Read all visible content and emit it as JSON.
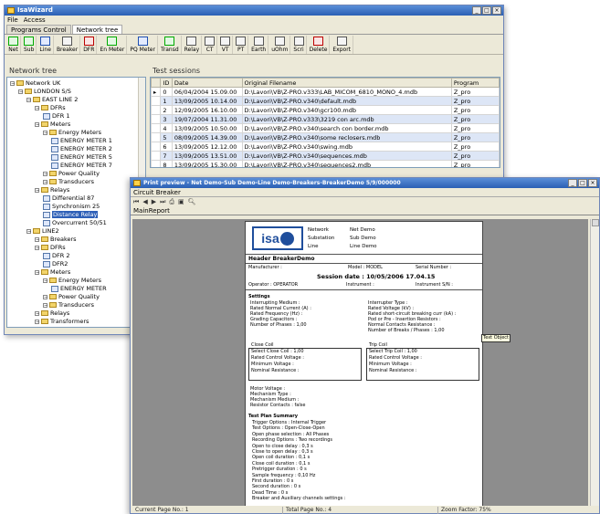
{
  "main": {
    "title": "IsaWizard",
    "menu": [
      "File",
      "Access"
    ],
    "tabs": [
      "Programs Control",
      "Network tree"
    ],
    "toolbar": [
      "Net",
      "Sub",
      "Line",
      "Breaker",
      "DFR",
      "En Meter",
      "PQ Meter",
      "Transd",
      "Relay",
      "CT",
      "VT",
      "PT",
      "Earth",
      "uOhm",
      "Scri",
      "Delete",
      "Export"
    ],
    "tree_title": "Network tree",
    "tree": [
      {
        "label": "Network UK",
        "depth": 0,
        "kind": "net"
      },
      {
        "label": "LONDON S/S",
        "depth": 1,
        "kind": "sub"
      },
      {
        "label": "EAST LINE 2",
        "depth": 2,
        "kind": "line"
      },
      {
        "label": "DFRs",
        "depth": 3,
        "kind": "folder"
      },
      {
        "label": "DFR 1",
        "depth": 4,
        "kind": "dev"
      },
      {
        "label": "Meters",
        "depth": 3,
        "kind": "folder"
      },
      {
        "label": "Energy Meters",
        "depth": 4,
        "kind": "folder"
      },
      {
        "label": "ENERGY METER 1",
        "depth": 5,
        "kind": "dev"
      },
      {
        "label": "ENERGY METER 2",
        "depth": 5,
        "kind": "dev"
      },
      {
        "label": "ENERGY METER 5",
        "depth": 5,
        "kind": "dev"
      },
      {
        "label": "ENERGY METER 7",
        "depth": 5,
        "kind": "dev"
      },
      {
        "label": "Power Quality",
        "depth": 4,
        "kind": "folder"
      },
      {
        "label": "Transducers",
        "depth": 4,
        "kind": "folder"
      },
      {
        "label": "Relays",
        "depth": 3,
        "kind": "folder"
      },
      {
        "label": "Differential 87",
        "depth": 4,
        "kind": "dev"
      },
      {
        "label": "Synchronism 25",
        "depth": 4,
        "kind": "dev"
      },
      {
        "label": "Distance Relay",
        "depth": 4,
        "kind": "dev",
        "selected": true
      },
      {
        "label": "Overcurrent 50/51",
        "depth": 4,
        "kind": "dev"
      },
      {
        "label": "LINE2",
        "depth": 2,
        "kind": "line"
      },
      {
        "label": "Breakers",
        "depth": 3,
        "kind": "folder"
      },
      {
        "label": "DFRs",
        "depth": 3,
        "kind": "folder"
      },
      {
        "label": "DFR 2",
        "depth": 4,
        "kind": "dev"
      },
      {
        "label": "DFR2",
        "depth": 4,
        "kind": "dev"
      },
      {
        "label": "Meters",
        "depth": 3,
        "kind": "folder"
      },
      {
        "label": "Energy Meters",
        "depth": 4,
        "kind": "folder"
      },
      {
        "label": "ENERGY METER",
        "depth": 5,
        "kind": "dev"
      },
      {
        "label": "Power Quality",
        "depth": 4,
        "kind": "folder"
      },
      {
        "label": "Transducers",
        "depth": 4,
        "kind": "folder"
      },
      {
        "label": "Relays",
        "depth": 3,
        "kind": "folder"
      },
      {
        "label": "Transformers",
        "depth": 3,
        "kind": "folder"
      }
    ],
    "sessions_title": "Test sessions",
    "session_columns": [
      "ID",
      "Date",
      "Original Filename",
      "Program"
    ],
    "sessions": [
      [
        "0",
        "06/04/2004 15.09.00",
        "D:\\Lavori\\VB\\Z-PRO.v333\\LAB_MICOM_6810_MONO_4.mdb",
        "Z_pro"
      ],
      [
        "1",
        "13/09/2005 10.14.00",
        "D:\\Lavori\\VB\\Z-PRO.v340\\default.mdb",
        "Z_pro"
      ],
      [
        "2",
        "12/09/2005 16.10.00",
        "D:\\Lavori\\VB\\Z-PRO.v340\\gcr100.mdb",
        "Z_pro"
      ],
      [
        "3",
        "19/07/2004 11.31.00",
        "D:\\Lavori\\VB\\Z-PRO.v333\\3219 con arc.mdb",
        "Z_pro"
      ],
      [
        "4",
        "13/09/2005 10.50.00",
        "D:\\Lavori\\VB\\Z-PRO.v340\\search con border.mdb",
        "Z_pro"
      ],
      [
        "5",
        "08/09/2005 14.39.00",
        "D:\\Lavori\\VB\\Z-PRO.v340\\some reclosers.mdb",
        "Z_pro"
      ],
      [
        "6",
        "13/09/2005 12.12.00",
        "D:\\Lavori\\VB\\Z-PRO.v340\\swing.mdb",
        "Z_pro"
      ],
      [
        "7",
        "13/09/2005 13.51.00",
        "D:\\Lavori\\VB\\Z-PRO.v340\\sequences.mdb",
        "Z_pro"
      ],
      [
        "8",
        "13/09/2005 15.30.00",
        "D:\\Lavori\\VB\\Z-PRO.v340\\sequences2.mdb",
        "Z_pro"
      ]
    ]
  },
  "preview": {
    "title": "Print preview - Net Demo-Sub Demo-Line Demo-Breakers-BreakerDemo 5/9/000000",
    "tab": "Circuit Breaker",
    "subtab": "MainReport",
    "report": {
      "hdr_labels": [
        "Network",
        "Substation",
        "Line"
      ],
      "hdr_values": [
        "Net Demo",
        "Sub Demo",
        "Line Demo"
      ],
      "header_title": "Header BreakerDemo",
      "manufacturer": "Manufacturer :",
      "model": "Model : MODEL",
      "serial": "Serial Number :",
      "session_date": "Session date : 10/05/2006  17.04.15",
      "operator": "Operator : OPERATOR",
      "instrument": "Instrument :",
      "instrument_sn": "Instrument S/N :",
      "settings": "Settings",
      "settings_left": [
        "Interrupting Medium :",
        "Rated Normal Current (A) :",
        "Rated Frequency (Hz) :",
        "Grading Capacitors :",
        "Number of Phases : 1,00"
      ],
      "settings_right": [
        "Interrupter Type :",
        "Rated Voltage (kV) :",
        "Rated short-circuit breaking curr (kA) :",
        "Pod or Pre - Insertion Resistors :",
        "Normal Contacts Resistance :",
        "Number of Breaks / Phases : 1,00"
      ],
      "close_coil": [
        "Close Coil",
        "Select Close Coil : 1,00",
        "Rated Control Voltage :",
        "Minimum Voltage :",
        "Nominal Resistance :"
      ],
      "trip_coil": [
        "Trip Coil",
        "Select Trip Coil : 1,00",
        "Rated Control Voltage :",
        "Minimum Voltage :",
        "Nominal Resistance :"
      ],
      "motor": [
        "Motor Voltage :",
        "Mechanism Type :",
        "Mechanism Medium :",
        "Resistor Contacts : false"
      ],
      "test_plan": "Test Plan Summary",
      "test_plan_items": [
        "Trigger Options : Internal Trigger",
        "Test Options : Open-Close-Open",
        "Open phase selection : All Phases",
        "Recording Options : Two recordings",
        "Open to close delay : 0,3 s",
        "Close to open delay : 0,3 s",
        "Open coil duration : 0,1 s",
        "Close coil duration : 0,1 s",
        "Pretrigger duration : 0 s",
        "Sample frequency : 0,10 Hz",
        "First duration : 0 s",
        "Second duration : 0 s",
        "Dead Time : 0 s",
        "Breaker and Auxiliary channels settings :"
      ],
      "tooltip": "Text Object"
    },
    "status": [
      "Current Page No.: 1",
      "Total Page No.: 4",
      "Zoom Factor: 75%"
    ]
  }
}
